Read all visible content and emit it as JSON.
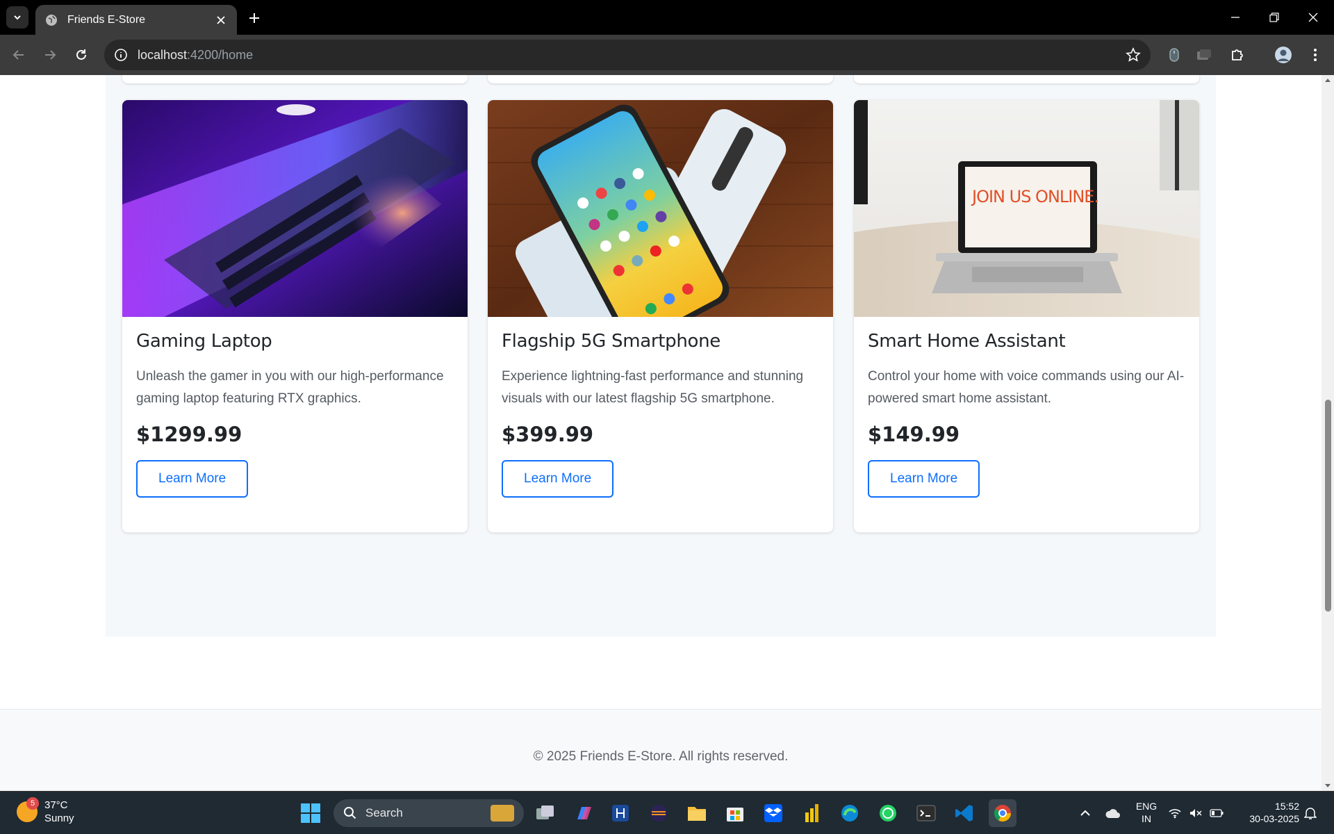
{
  "browser": {
    "tab_title": "Friends E-Store",
    "url_host": "localhost",
    "url_path": ":4200/home"
  },
  "products": [
    {
      "name": "Gaming Laptop",
      "description": "Unleash the gamer in you with our high-performance gaming laptop featuring RTX graphics.",
      "price": "$1299.99",
      "button": "Learn More"
    },
    {
      "name": "Flagship 5G Smartphone",
      "description": "Experience lightning-fast performance and stunning visuals with our latest flagship 5G smartphone.",
      "price": "$399.99",
      "button": "Learn More"
    },
    {
      "name": "Smart Home Assistant",
      "description": "Control your home with voice commands using our AI-powered smart home assistant.",
      "price": "$149.99",
      "button": "Learn More"
    }
  ],
  "footer": {
    "text": "© 2025 Friends E-Store. All rights reserved."
  },
  "laptop_screen_text": "JOIN US ONLINE.",
  "taskbar": {
    "weather_temp": "37°C",
    "weather_desc": "Sunny",
    "weather_badge": "5",
    "search_label": "Search",
    "lang_line1": "ENG",
    "lang_line2": "IN",
    "time": "15:52",
    "date": "30-03-2025"
  },
  "colors": {
    "accent": "#0d6efd",
    "section_bg": "#f5f8fb"
  }
}
